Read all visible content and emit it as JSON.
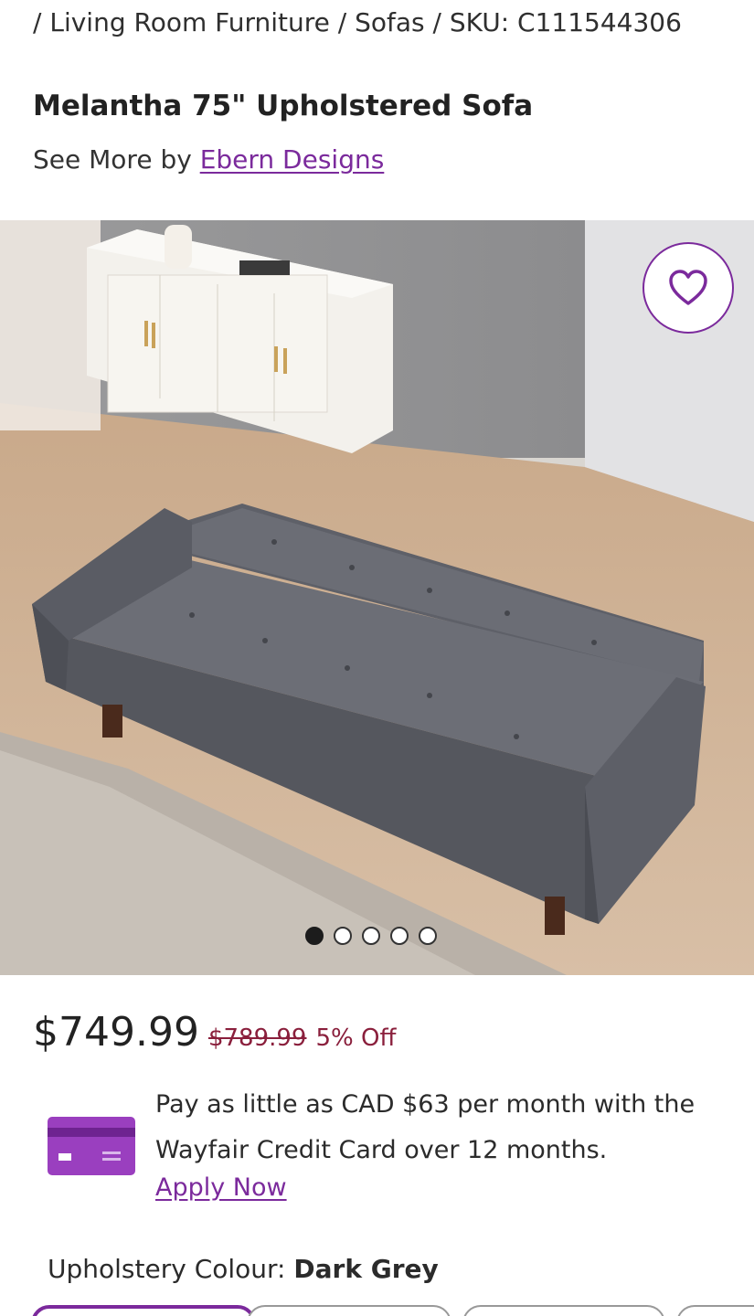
{
  "breadcrumb": {
    "sep1": "/ ",
    "item1": "Living Room Furniture",
    "sep2": " / ",
    "item2": "Sofas",
    "sep3": " / ",
    "sku": "SKU: C111544306"
  },
  "product": {
    "title": "Melantha 75\" Upholstered Sofa",
    "see_more_prefix": "See More by ",
    "brand": "Ebern Designs"
  },
  "gallery": {
    "image_count": 5,
    "active_index": 0,
    "favorite_icon": "heart-icon"
  },
  "pricing": {
    "price": "$749.99",
    "was_price": "$789.99",
    "discount": "5% Off"
  },
  "finance": {
    "text": "Pay as little as CAD $63 per month with the Wayfair Credit Card over 12 months.",
    "cta": "Apply Now",
    "icon": "credit-card-icon"
  },
  "options": {
    "colour_label": "Upholstery Colour: ",
    "colour_value": "Dark Grey"
  },
  "colors": {
    "accent": "#7b2a9c",
    "sale": "#8a1f3c"
  }
}
